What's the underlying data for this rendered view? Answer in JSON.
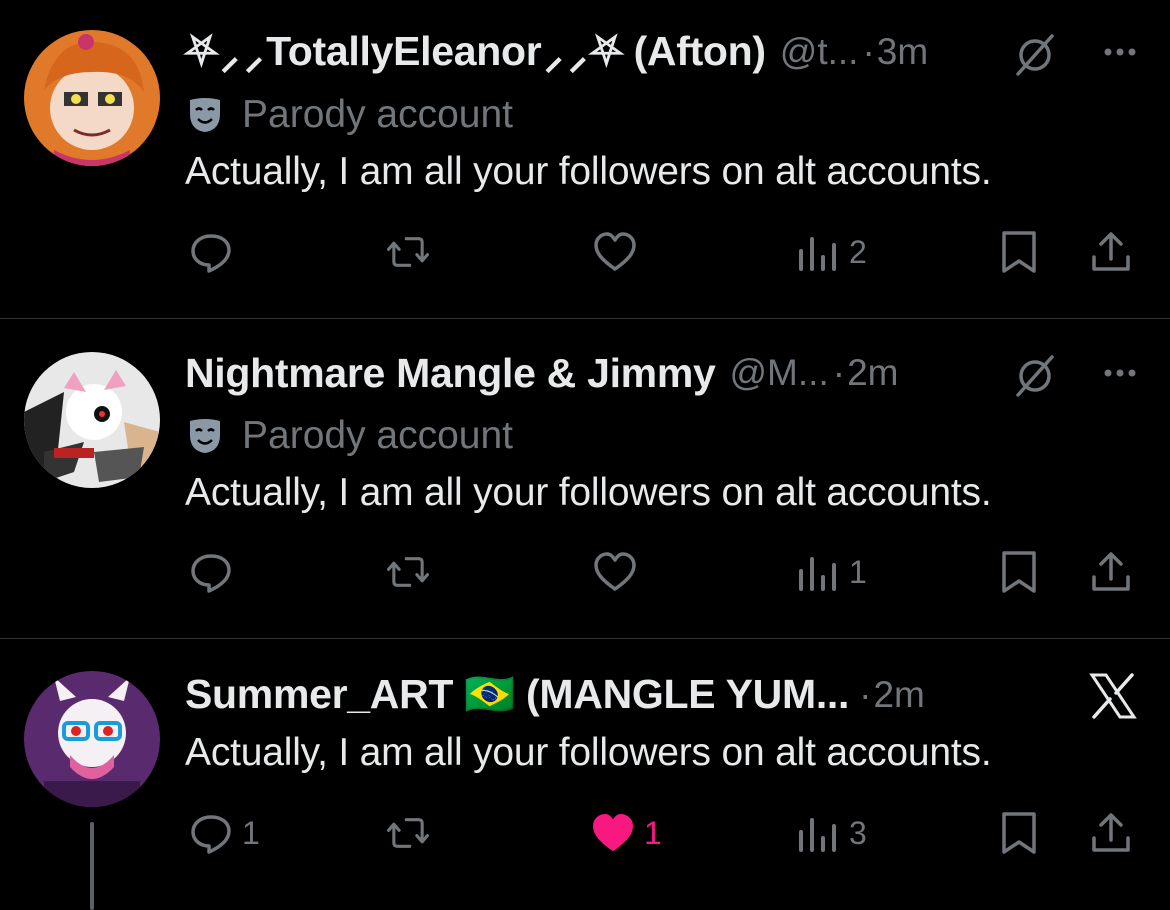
{
  "tweets": [
    {
      "display_name": "⛧⸝⸝TotallyEleanor⸝⸝⛧ (Afton)",
      "handle": "@t...",
      "dot": "·",
      "time": "3m",
      "parody_label": "Parody account",
      "text": "Actually, I am all your followers on alt accounts.",
      "reply_count": "",
      "retweet_count": "",
      "like_count": "",
      "view_count": "2",
      "liked": false
    },
    {
      "display_name": "Nightmare Mangle & Jimmy",
      "handle": "@M...",
      "dot": "·",
      "time": "2m",
      "parody_label": "Parody account",
      "text": "Actually, I am all your followers on alt accounts.",
      "reply_count": "",
      "retweet_count": "",
      "like_count": "",
      "view_count": "1",
      "liked": false
    },
    {
      "display_name": "Summer_ART 🇧🇷 (MANGLE YUM...",
      "handle": "",
      "dot": "·",
      "time": "2m",
      "parody_label": "",
      "text": "Actually, I am all your followers on alt accounts.",
      "reply_count": "1",
      "retweet_count": "",
      "like_count": "1",
      "view_count": "3",
      "liked": true
    }
  ],
  "colors": {
    "background": "#000000",
    "text": "#e7e9ea",
    "muted": "#71767b",
    "like": "#f91880",
    "divider": "#2f3336"
  },
  "icons": [
    "reply-icon",
    "retweet-icon",
    "like-icon",
    "views-icon",
    "bookmark-icon",
    "share-icon",
    "grok-icon",
    "more-icon",
    "x-logo-icon",
    "parody-mask-icon"
  ]
}
